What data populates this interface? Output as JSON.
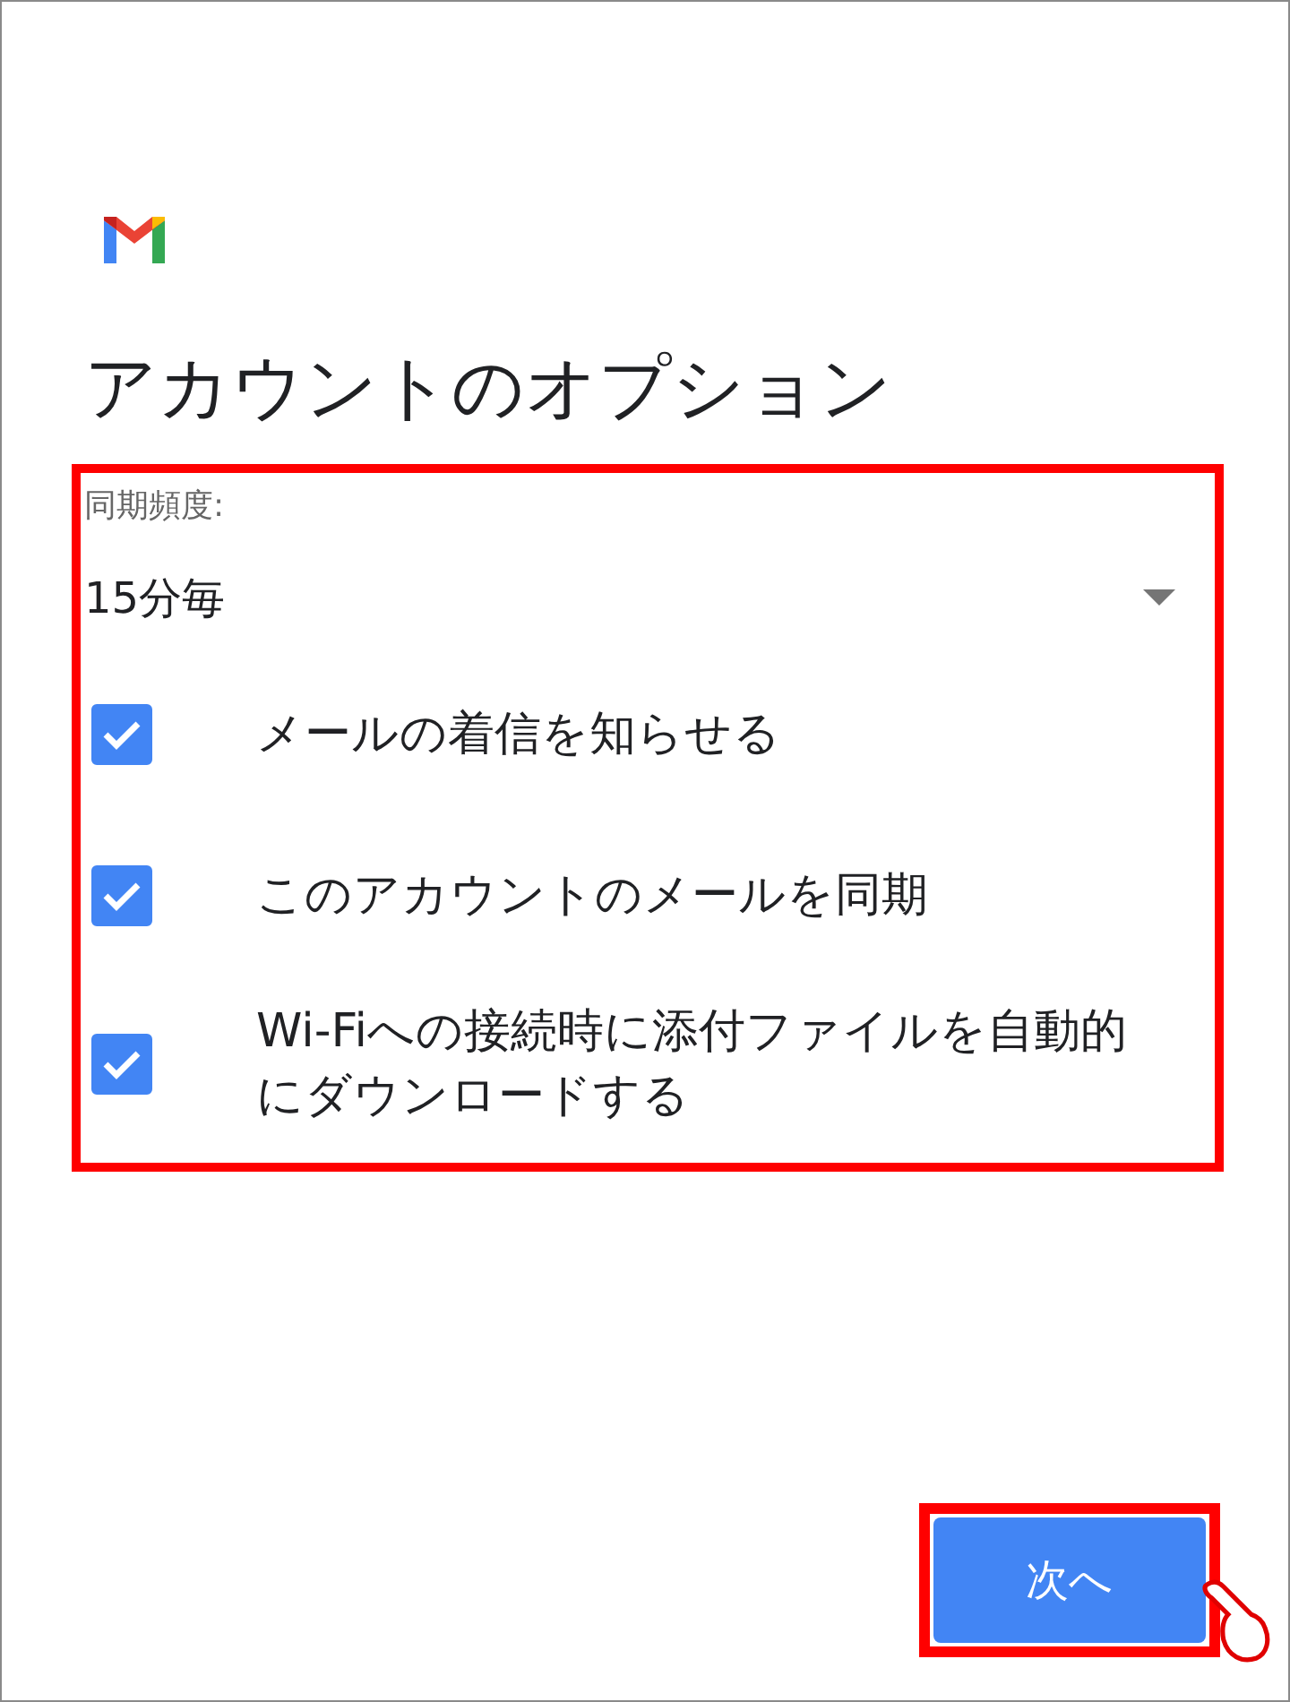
{
  "title": "アカウントのオプション",
  "sync_frequency": {
    "label": "同期頻度:",
    "value": "15分毎"
  },
  "options": [
    {
      "label": "メールの着信を知らせる",
      "checked": true
    },
    {
      "label": "このアカウントのメールを同期",
      "checked": true
    },
    {
      "label": "Wi-Fiへの接続時に添付ファイルを自動的にダウンロードする",
      "checked": true
    }
  ],
  "next_button": "次へ"
}
